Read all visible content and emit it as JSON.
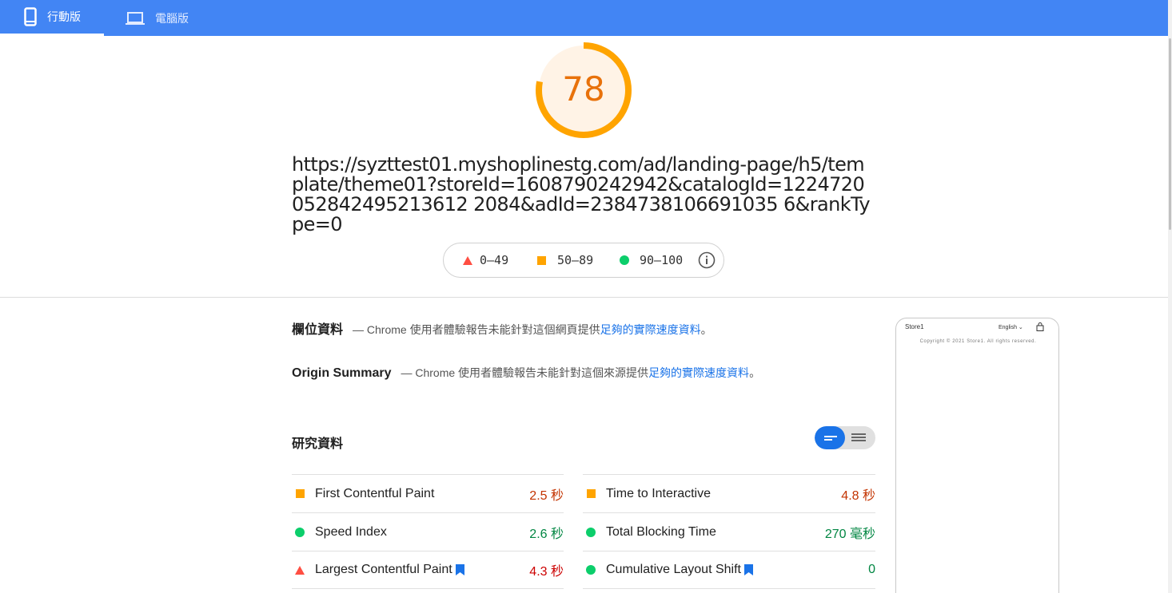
{
  "tabs": {
    "mobile": "行動版",
    "desktop": "電腦版"
  },
  "score": {
    "value": "78",
    "fraction": 0.78,
    "color": "#ffa400"
  },
  "url": "https://syzttest01.myshoplinestg.com/ad/landing-page/h5/template/theme01?storeId=1608790242942&catalogId=1224720052842495213612 2084&adId=2384738106691035 6&rankType=0",
  "legend": {
    "fail": "0–49",
    "average": "50–89",
    "pass": "90–100",
    "info_icon": "info-icon"
  },
  "field_data": {
    "title": "欄位資料",
    "desc_prefix": "— Chrome 使用者體驗報告未能針對這個網頁提供",
    "link": "足夠的實際速度資料",
    "desc_suffix": "。"
  },
  "origin_summary": {
    "title": "Origin Summary",
    "desc_prefix": "— Chrome 使用者體驗報告未能針對這個來源提供",
    "link": "足夠的實際速度資料",
    "desc_suffix": "。"
  },
  "lab_data": {
    "title": "研究資料"
  },
  "metrics": {
    "left": [
      {
        "name": "First Contentful Paint",
        "value": "2.5 秒",
        "status": "average"
      },
      {
        "name": "Speed Index",
        "value": "2.6 秒",
        "status": "pass"
      },
      {
        "name": "Largest Contentful Paint",
        "value": "4.3 秒",
        "status": "fail",
        "bookmark": true
      }
    ],
    "right": [
      {
        "name": "Time to Interactive",
        "value": "4.8 秒",
        "status": "average"
      },
      {
        "name": "Total Blocking Time",
        "value": "270 毫秒",
        "status": "pass"
      },
      {
        "name": "Cumulative Layout Shift",
        "value": "0",
        "status": "pass",
        "bookmark": true
      }
    ]
  },
  "screenshot": {
    "store": "Store1",
    "language": "English",
    "copyright": "Copyright © 2021 Store1. All rights reserved."
  },
  "colors": {
    "header": "#4285f4",
    "accent": "#1a73e8",
    "average": "#ffa400",
    "pass": "#0cce6b",
    "fail": "#ff4e42"
  }
}
